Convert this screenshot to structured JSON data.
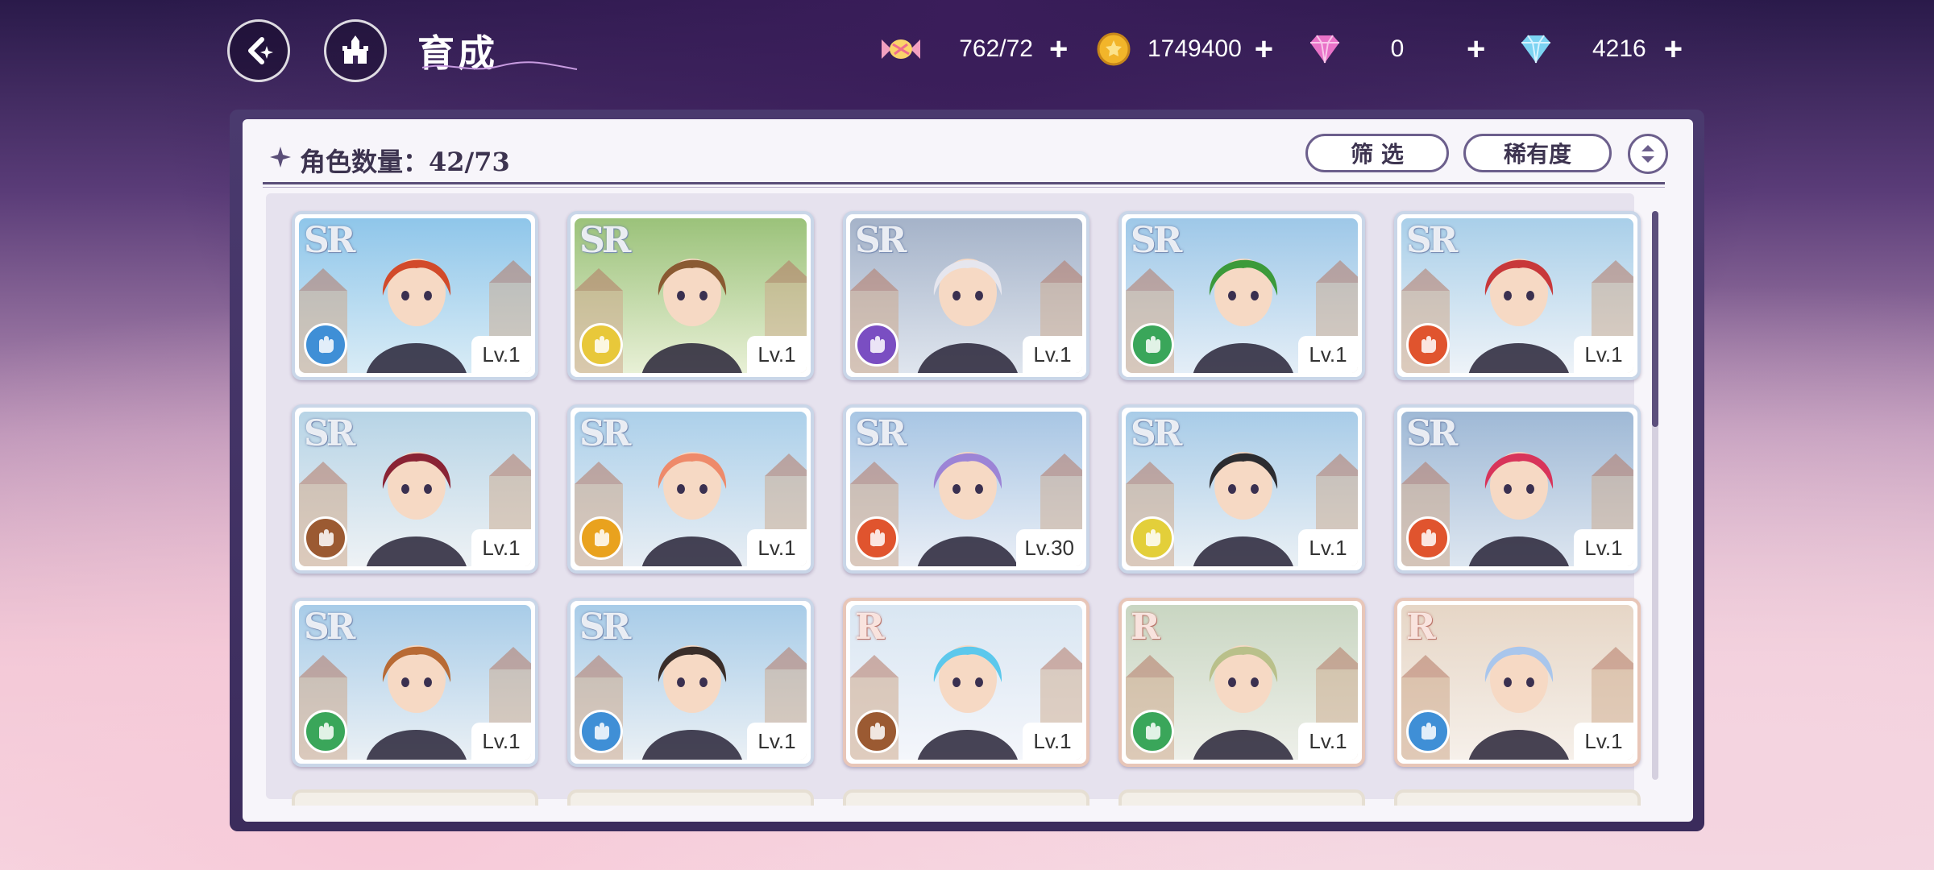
{
  "header": {
    "title": "育成",
    "resources": [
      {
        "icon": "candy-icon",
        "value": "762/72"
      },
      {
        "icon": "gold-coin-icon",
        "value": "1749400"
      },
      {
        "icon": "pink-gem-icon",
        "value": "0"
      },
      {
        "icon": "blue-diamond-icon",
        "value": "4216"
      }
    ],
    "plus_label": "+"
  },
  "panel": {
    "count_label": "角色数量：42/73",
    "filter_label": "筛 选",
    "rarity_label": "稀有度"
  },
  "cards": [
    {
      "rarity": "SR",
      "level": "Lv.1",
      "class_color": "#3f8fd6",
      "palette": [
        "#8fc6ea",
        "#d9ecf6"
      ],
      "hair": "#d24a2a"
    },
    {
      "rarity": "SR",
      "level": "Lv.1",
      "class_color": "#e8c83a",
      "palette": [
        "#9bc27a",
        "#e8f0d6"
      ],
      "hair": "#8a5a32"
    },
    {
      "rarity": "SR",
      "level": "Lv.1",
      "class_color": "#7a4ec2",
      "palette": [
        "#a5b3c9",
        "#dfe5ee"
      ],
      "hair": "#e6e6ee"
    },
    {
      "rarity": "SR",
      "level": "Lv.1",
      "class_color": "#3aa65a",
      "palette": [
        "#9ec8e8",
        "#e4eef7"
      ],
      "hair": "#3c9a3a"
    },
    {
      "rarity": "SR",
      "level": "Lv.1",
      "class_color": "#e0542e",
      "palette": [
        "#a9cfe9",
        "#eef3f8"
      ],
      "hair": "#c8383a"
    },
    {
      "rarity": "SR",
      "level": "Lv.1",
      "class_color": "#9b5a32",
      "palette": [
        "#b7d4e6",
        "#eef2f5"
      ],
      "hair": "#8a2334"
    },
    {
      "rarity": "SR",
      "level": "Lv.1",
      "class_color": "#e9a21e",
      "palette": [
        "#acd0ea",
        "#e8eef4"
      ],
      "hair": "#ee8a6a"
    },
    {
      "rarity": "SR",
      "level": "Lv.30",
      "class_color": "#e0542e",
      "palette": [
        "#a8c6e4",
        "#e9eef6"
      ],
      "hair": "#9c84d6"
    },
    {
      "rarity": "SR",
      "level": "Lv.1",
      "class_color": "#e3cf3a",
      "palette": [
        "#a8cce8",
        "#eaf0f5"
      ],
      "hair": "#2c2c30"
    },
    {
      "rarity": "SR",
      "level": "Lv.1",
      "class_color": "#e0542e",
      "palette": [
        "#9fb9d6",
        "#dde6f0"
      ],
      "hair": "#d8345a"
    },
    {
      "rarity": "SR",
      "level": "Lv.1",
      "class_color": "#3aa65a",
      "palette": [
        "#a8cce8",
        "#eaf0f5"
      ],
      "hair": "#b86a34"
    },
    {
      "rarity": "SR",
      "level": "Lv.1",
      "class_color": "#3f8fd6",
      "palette": [
        "#a8cce8",
        "#eaf0f5"
      ],
      "hair": "#3a2e2a"
    },
    {
      "rarity": "R",
      "level": "Lv.1",
      "class_color": "#9b5a32",
      "palette": [
        "#d9e6f2",
        "#f4f6fb"
      ],
      "hair": "#5cc8ec"
    },
    {
      "rarity": "R",
      "level": "Lv.1",
      "class_color": "#3aa65a",
      "palette": [
        "#c9d6c2",
        "#eef0ea"
      ],
      "hair": "#b9c08a"
    },
    {
      "rarity": "R",
      "level": "Lv.1",
      "class_color": "#3f8fd6",
      "palette": [
        "#e6d6c6",
        "#f6f0ea"
      ],
      "hair": "#a9c6ec"
    }
  ]
}
